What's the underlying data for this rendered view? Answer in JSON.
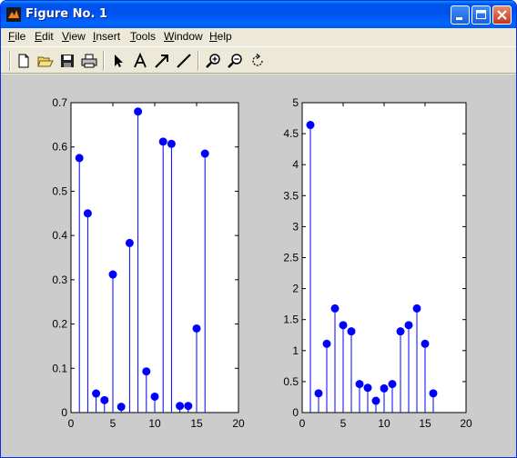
{
  "window": {
    "title": "Figure No. 1"
  },
  "menu": {
    "items": [
      {
        "key": "F",
        "rest": "ile"
      },
      {
        "key": "E",
        "rest": "dit"
      },
      {
        "key": "V",
        "rest": "iew"
      },
      {
        "key": "I",
        "rest": "nsert"
      },
      {
        "key": "T",
        "rest": "ools"
      },
      {
        "key": "W",
        "rest": "indow"
      },
      {
        "key": "H",
        "rest": "elp"
      }
    ]
  },
  "toolbar": {
    "tools": [
      "new-file-icon",
      "open-folder-icon",
      "save-icon",
      "print-icon",
      "select-arrow-icon",
      "insert-text-icon",
      "insert-arrow-icon",
      "insert-line-icon",
      "zoom-in-icon",
      "zoom-out-icon",
      "rotate-3d-icon"
    ]
  },
  "colors": {
    "stem": "#0000ff",
    "background": "#cccccc",
    "title_bar": "#0054e3"
  },
  "chart_data": [
    {
      "type": "stem",
      "x": [
        1,
        2,
        3,
        4,
        5,
        6,
        7,
        8,
        9,
        10,
        11,
        12,
        13,
        14,
        15,
        16
      ],
      "values": [
        0.575,
        0.45,
        0.043,
        0.028,
        0.312,
        0.013,
        0.383,
        0.68,
        0.093,
        0.036,
        0.612,
        0.607,
        0.015,
        0.015,
        0.19,
        0.585
      ],
      "xlim": [
        0,
        20
      ],
      "ylim": [
        0,
        0.7
      ],
      "xticks": [
        "0",
        "5",
        "10",
        "15",
        "20"
      ],
      "yticks": [
        "0",
        "0.1",
        "0.2",
        "0.3",
        "0.4",
        "0.5",
        "0.6",
        "0.7"
      ]
    },
    {
      "type": "stem",
      "x": [
        1,
        2,
        3,
        4,
        5,
        6,
        7,
        8,
        9,
        10,
        11,
        12,
        13,
        14,
        15,
        16
      ],
      "values": [
        4.64,
        0.31,
        1.11,
        1.68,
        1.41,
        1.31,
        0.46,
        0.4,
        0.19,
        0.39,
        0.46,
        1.31,
        1.41,
        1.68,
        1.11,
        0.31
      ],
      "xlim": [
        0,
        20
      ],
      "ylim": [
        0,
        5
      ],
      "xticks": [
        "0",
        "5",
        "10",
        "15",
        "20"
      ],
      "yticks": [
        "0",
        "0.5",
        "1",
        "1.5",
        "2",
        "2.5",
        "3",
        "3.5",
        "4",
        "4.5",
        "5"
      ]
    }
  ]
}
